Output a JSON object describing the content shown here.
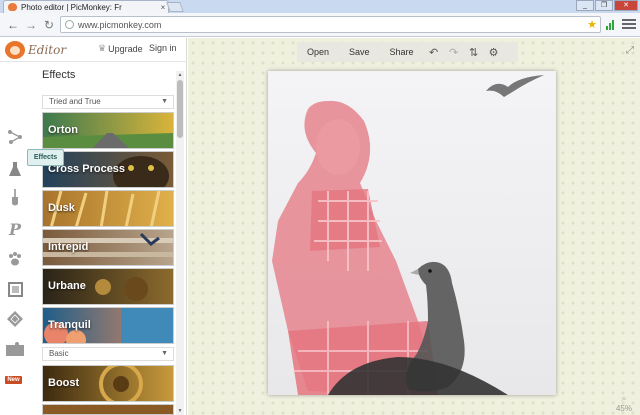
{
  "browser": {
    "tab_title": "Photo editor | PicMonkey: Fr",
    "tab_close": "×",
    "url": "www.picmonkey.com",
    "window_buttons": [
      "_",
      "❐",
      "✕"
    ]
  },
  "header": {
    "logo_text": "Editor",
    "upgrade_label": "Upgrade",
    "signin_label": "Sign in"
  },
  "tools": [
    {
      "name": "basic-edits",
      "icon": "nodes-icon"
    },
    {
      "name": "effects",
      "icon": "flask-icon"
    },
    {
      "name": "touch-up",
      "icon": "brush-icon"
    },
    {
      "name": "text",
      "icon": "text-p-icon"
    },
    {
      "name": "overlays",
      "icon": "paw-icon"
    },
    {
      "name": "frames",
      "icon": "frame-icon"
    },
    {
      "name": "textures",
      "icon": "diamond-icon"
    },
    {
      "name": "themes",
      "icon": "new-theme-icon"
    }
  ],
  "tooltip": "Effects",
  "new_badge": "New",
  "panel": {
    "title": "Effects",
    "section1": "Tried and True",
    "section2": "Basic",
    "effects": [
      {
        "label": "Orton",
        "c1": "#3d7a4e",
        "c2": "#d9b43a"
      },
      {
        "label": "Cross Process",
        "c1": "#23415b",
        "c2": "#7a5b36"
      },
      {
        "label": "Dusk",
        "c1": "#a8742c",
        "c2": "#e0b04a"
      },
      {
        "label": "Intrepid",
        "c1": "#7a5a3c",
        "c2": "#b8a48c"
      },
      {
        "label": "Urbane",
        "c1": "#2a2418",
        "c2": "#8c6a2c"
      },
      {
        "label": "Tranquil",
        "c1": "#1f5e8a",
        "c2": "#e08a5c"
      }
    ],
    "basic_effects": [
      {
        "label": "Boost",
        "c1": "#3c2a10",
        "c2": "#c89a3c"
      }
    ]
  },
  "canvas_toolbar": {
    "open": "Open",
    "save": "Save",
    "share": "Share",
    "undo_icon": "undo-icon",
    "redo_icon": "redo-icon",
    "layers_icon": "layers-icon",
    "settings_icon": "gear-icon"
  },
  "zoom_level": "45%"
}
